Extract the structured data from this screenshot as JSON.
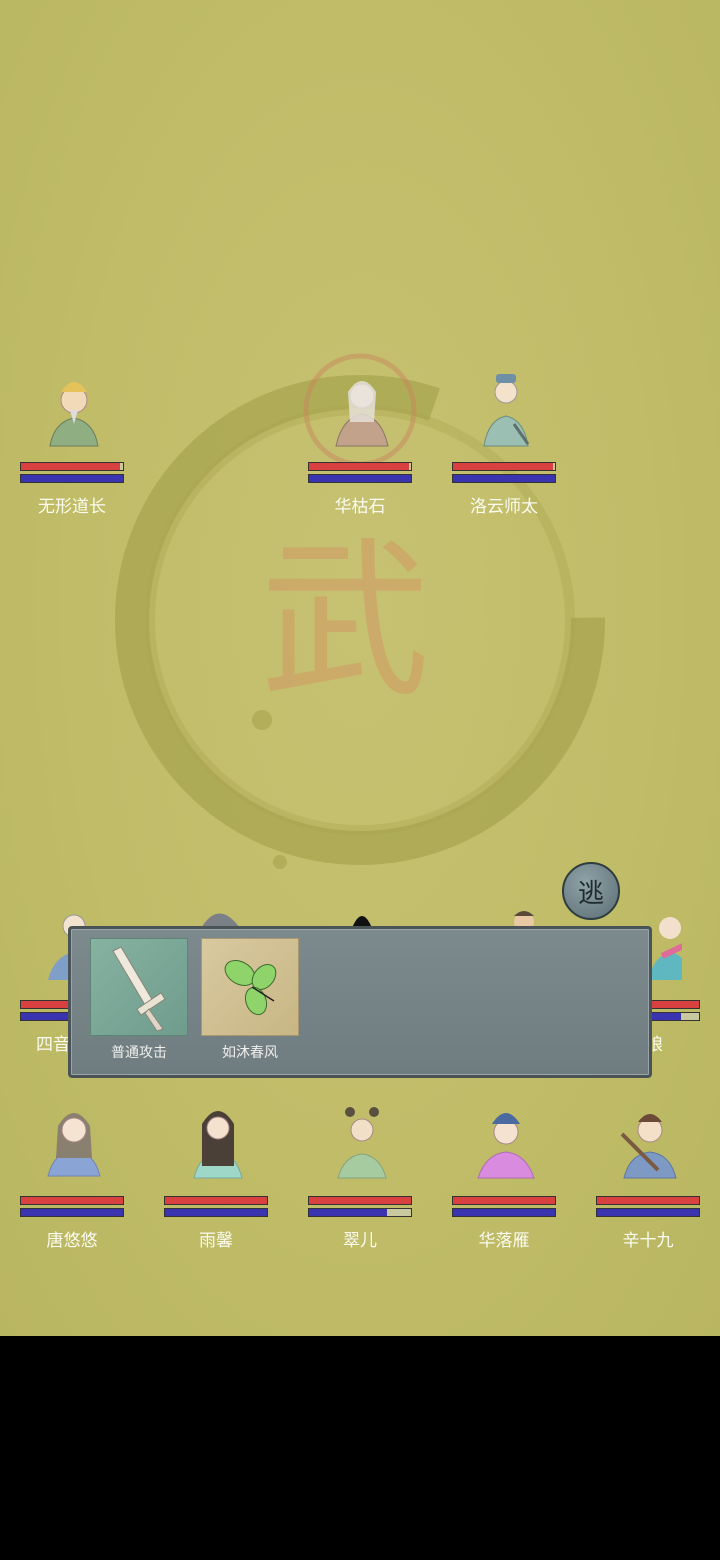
{
  "background_glyph": "武",
  "enemies": [
    {
      "name": "无形道长",
      "hp": 0.97,
      "mp": 1.0
    },
    {
      "name": "华枯石",
      "hp": 0.98,
      "mp": 1.0
    },
    {
      "name": "洛云师太",
      "hp": 0.98,
      "mp": 1.0
    }
  ],
  "allies_row1": [
    {
      "name": "四音",
      "hp": 1.0,
      "mp": 1.0
    },
    {
      "name": "",
      "hp": 1.0,
      "mp": 1.0
    },
    {
      "name": "",
      "hp": 1.0,
      "mp": 1.0
    },
    {
      "name": "",
      "hp": 1.0,
      "mp": 1.0
    },
    {
      "name": "娘",
      "hp": 1.0,
      "mp": 0.82
    }
  ],
  "allies_row2": [
    {
      "name": "唐悠悠",
      "hp": 1.0,
      "mp": 1.0
    },
    {
      "name": "雨馨",
      "hp": 1.0,
      "mp": 1.0
    },
    {
      "name": "翠儿",
      "hp": 1.0,
      "mp": 0.76
    },
    {
      "name": "华落雁",
      "hp": 1.0,
      "mp": 1.0
    },
    {
      "name": "辛十九",
      "hp": 1.0,
      "mp": 1.0
    }
  ],
  "skills": [
    {
      "label": "普通攻击",
      "icon": "sword-icon"
    },
    {
      "label": "如沐春风",
      "icon": "leaves-icon"
    }
  ],
  "flee_label": "逃",
  "colors": {
    "hp": "#d94040",
    "mp": "#3a34b0",
    "background": "#c0bc68",
    "panel": "#76838a"
  }
}
